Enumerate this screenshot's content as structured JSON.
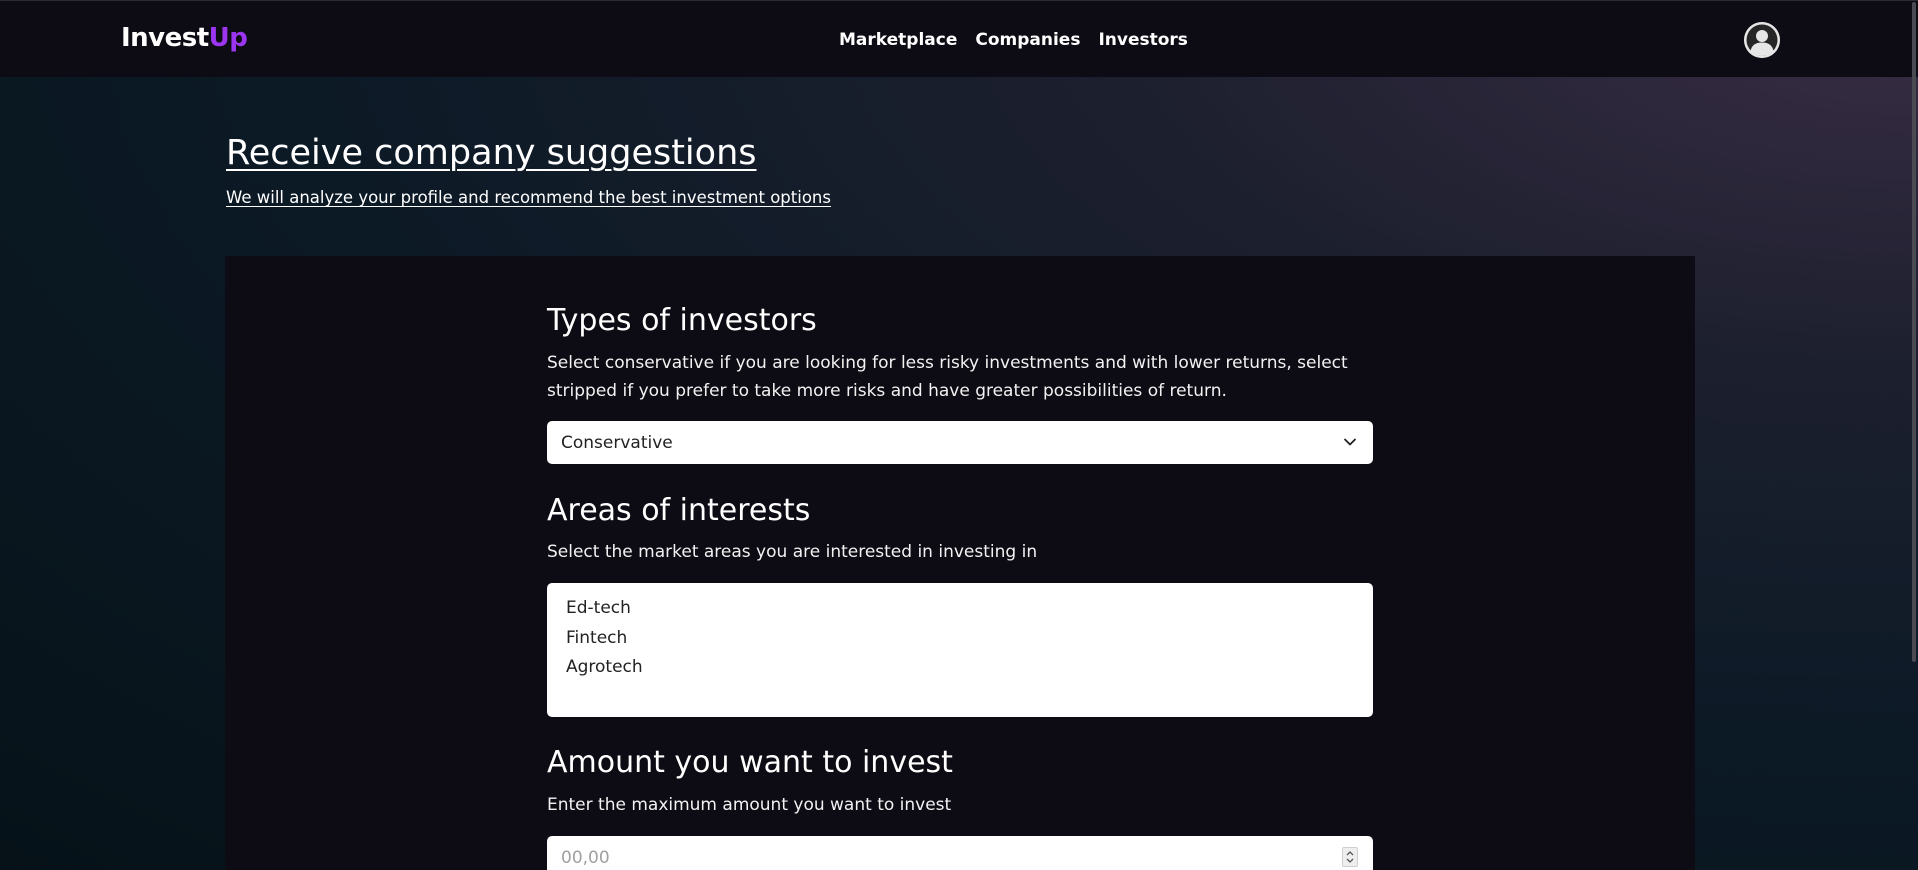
{
  "nav": {
    "brand_part1": "Invest",
    "brand_part2": "Up",
    "links": [
      "Marketplace",
      "Companies",
      "Investors"
    ],
    "avatar_icon": "user-avatar-icon"
  },
  "hero": {
    "title": "Receive company suggestions",
    "subtitle": "We will analyze your profile and recommend the best investment options"
  },
  "investor_types": {
    "title": "Types of investors",
    "description": "Select conservative if you are looking for less risky investments and with lower returns, select stripped if you prefer to take more risks and have greater possibilities of return.",
    "selected": "Conservative"
  },
  "areas": {
    "title": "Areas of interests",
    "description": "Select the market areas you are interested in investing in",
    "options": [
      "Ed-tech",
      "Fintech",
      "Agrotech"
    ]
  },
  "amount": {
    "title": "Amount you want to invest",
    "description": "Enter the maximum amount you want to invest",
    "placeholder": "00,00"
  },
  "colors": {
    "brand_accent": "#9b35f0",
    "navbar_bg": "#0d0c14",
    "panel_bg": "#0d0c14"
  }
}
